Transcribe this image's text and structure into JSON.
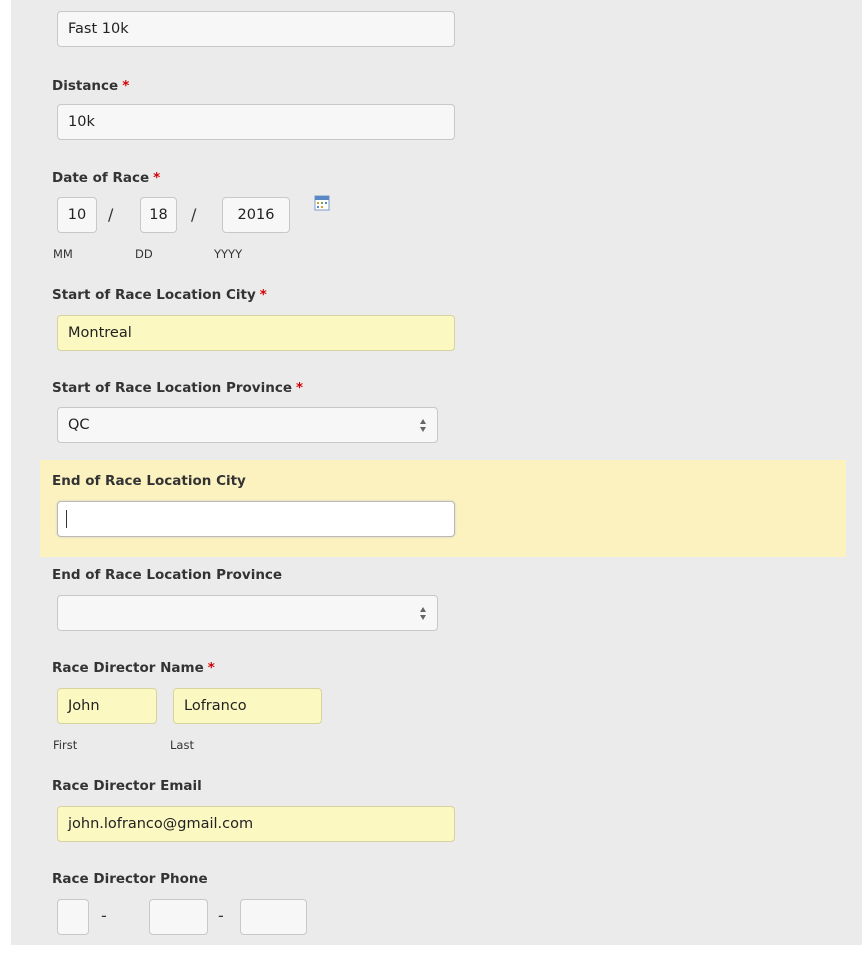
{
  "form": {
    "race_name": {
      "value": "Fast 10k"
    },
    "distance": {
      "label": "Distance",
      "required_mark": "*",
      "value": "10k"
    },
    "date_of_race": {
      "label": "Date of Race",
      "required_mark": "*",
      "month": "10",
      "day": "18",
      "year": "2016",
      "separator": "/",
      "month_label": "MM",
      "day_label": "DD",
      "year_label": "YYYY",
      "calendar_icon": "calendar-icon"
    },
    "start_city": {
      "label": "Start of Race Location City",
      "required_mark": "*",
      "value": "Montreal"
    },
    "start_province": {
      "label": "Start of Race Location Province",
      "required_mark": "*",
      "value": "QC"
    },
    "end_city": {
      "label": "End of Race Location City",
      "value": ""
    },
    "end_province": {
      "label": "End of Race Location Province",
      "value": ""
    },
    "director_name": {
      "label": "Race Director Name",
      "required_mark": "*",
      "first": "John",
      "last": "Lofranco",
      "first_label": "First",
      "last_label": "Last"
    },
    "director_email": {
      "label": "Race Director Email",
      "value": "john.lofranco@gmail.com"
    },
    "director_phone": {
      "label": "Race Director Phone",
      "separator": "-",
      "area": "",
      "prefix": "",
      "line": ""
    }
  },
  "colors": {
    "required": "#d40000",
    "autofill_background": "#fbf8c2",
    "focused_row_highlight": "#fcf2c0",
    "panel_background": "#ebebeb"
  }
}
